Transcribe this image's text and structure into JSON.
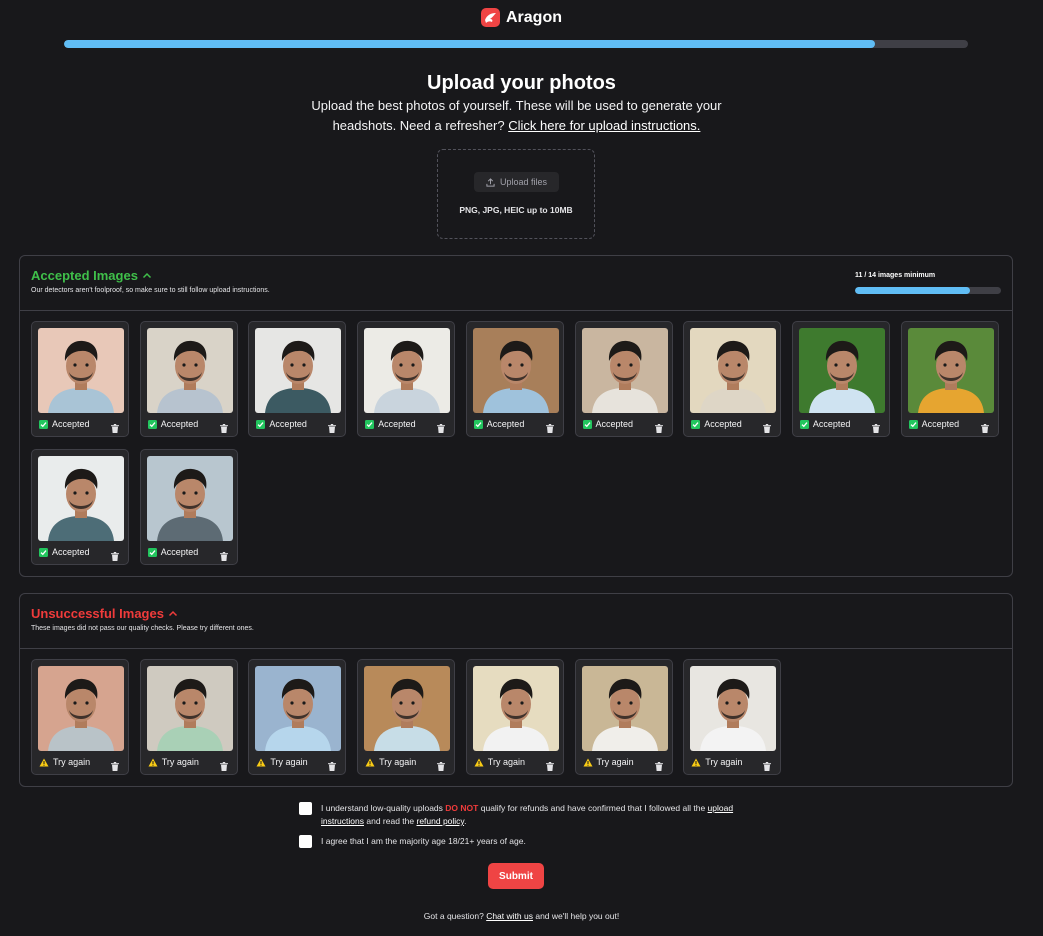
{
  "brand": {
    "name": "Aragon",
    "accent": "#ef4444"
  },
  "progress": {
    "fraction": 0.897
  },
  "header": {
    "title": "Upload your photos",
    "subtitle": "Upload the best photos of yourself. These will be used to generate your headshots. Need a refresher?",
    "instructions_link": "Click here for upload instructions."
  },
  "dropzone": {
    "button_label": "Upload files",
    "button_icon": "upload-icon",
    "formats": "PNG, JPG, HEIC up to 10MB"
  },
  "accepted": {
    "title": "Accepted Images",
    "title_color": "#3fbf4a",
    "description": "Our detectors aren't foolproof, so make sure to still follow upload instructions.",
    "counter": "11 / 14 images minimum",
    "counter_fraction": 0.786,
    "status_label": "Accepted",
    "images": [
      {
        "bg": "#e8c8b8",
        "shirt": "#a9c4d6"
      },
      {
        "bg": "#d9d3c8",
        "shirt": "#b7c3cf"
      },
      {
        "bg": "#e6e6e4",
        "shirt": "#3c5a62"
      },
      {
        "bg": "#ecebe6",
        "shirt": "#c9d4dd"
      },
      {
        "bg": "#a87f5a",
        "shirt": "#9fc2dc"
      },
      {
        "bg": "#c9b6a0",
        "shirt": "#e7e3dc"
      },
      {
        "bg": "#e3d8bf",
        "shirt": "#ded6c6"
      },
      {
        "bg": "#3e7a2e",
        "shirt": "#cfe3f1"
      },
      {
        "bg": "#5a8a3a",
        "shirt": "#e6a530"
      },
      {
        "bg": "#e9ecec",
        "shirt": "#4d6d77"
      },
      {
        "bg": "#b8c6cf",
        "shirt": "#5d6b74"
      }
    ]
  },
  "unsuccessful": {
    "title": "Unsuccessful Images",
    "title_color": "#ef3b3b",
    "description": "These images did not pass our quality checks. Please try different ones.",
    "status_label": "Try again",
    "images": [
      {
        "bg": "#d6a48f",
        "shirt": "#b9c3c8"
      },
      {
        "bg": "#cfcac0",
        "shirt": "#a9d0b6"
      },
      {
        "bg": "#9ab4cf",
        "shirt": "#b6d6ec"
      },
      {
        "bg": "#b88a5a",
        "shirt": "#c7dde7"
      },
      {
        "bg": "#e6dcc0",
        "shirt": "#f2f2f2"
      },
      {
        "bg": "#c9b796",
        "shirt": "#f0eeea"
      },
      {
        "bg": "#e8e6e1",
        "shirt": "#f3f3f3"
      }
    ]
  },
  "consent": {
    "refund_pre": "I understand low-quality uploads",
    "refund_emph": "DO NOT",
    "refund_mid": "qualify for refunds and have confirmed that I followed all the",
    "upload_link": "upload instructions",
    "refund_and": "and read the",
    "refund_link": "refund policy",
    "refund_end": ".",
    "age": "I agree that I am the majority age 18/21+ years of age."
  },
  "submit_label": "Submit",
  "help": {
    "pre": "Got a question?",
    "link": "Chat with us",
    "post": "and we'll help you out!"
  }
}
